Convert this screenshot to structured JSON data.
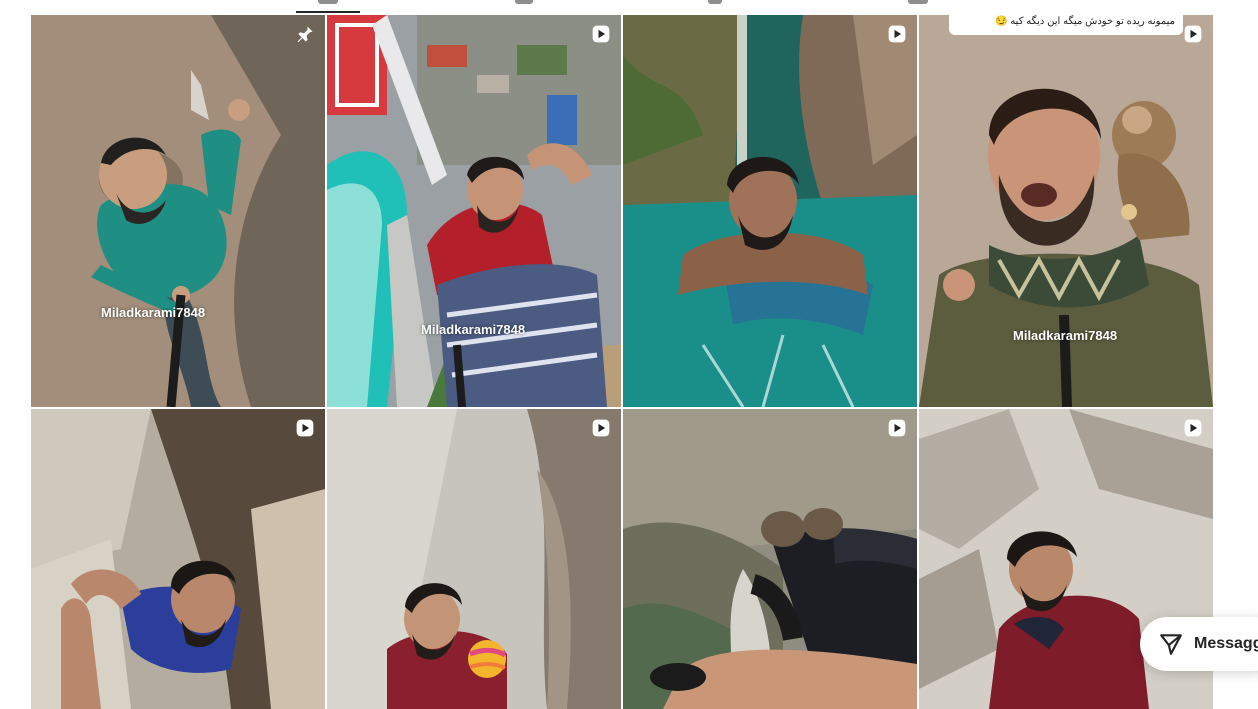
{
  "profile_tabs": {
    "active": "reels-tab"
  },
  "colors": {
    "accent_text": "#262626",
    "tab_inactive": "#8e8e8e",
    "page_bg": "#ffffff"
  },
  "grid": {
    "tiles": [
      {
        "icon": "pin-icon",
        "watermark": "Miladkarami7848",
        "scene": "climber on rock wall in green jacket"
      },
      {
        "icon": "reel-icon",
        "watermark": "Miladkarami7848",
        "scene": "man on top of water slide tower"
      },
      {
        "icon": "reel-icon",
        "watermark": "",
        "scene": "man swimming in canyon river"
      },
      {
        "icon": "reel-icon",
        "watermark": "Miladkarami7848",
        "caption": "میمونه ریده تو خودش میگه این دیگه کیه 😏",
        "scene": "man with monkey on shoulder"
      },
      {
        "icon": "reel-icon",
        "watermark": "",
        "scene": "man climbing in blue shirt"
      },
      {
        "icon": "reel-icon",
        "watermark": "",
        "scene": "man with ball in rock chimney"
      },
      {
        "icon": "reel-icon",
        "watermark": "",
        "scene": "feet hanging over cliff"
      },
      {
        "icon": "reel-icon",
        "watermark": "",
        "scene": "man in red shirt on rocks"
      }
    ]
  },
  "messages_button": {
    "label": "Messaggi",
    "icon": "send-icon"
  }
}
